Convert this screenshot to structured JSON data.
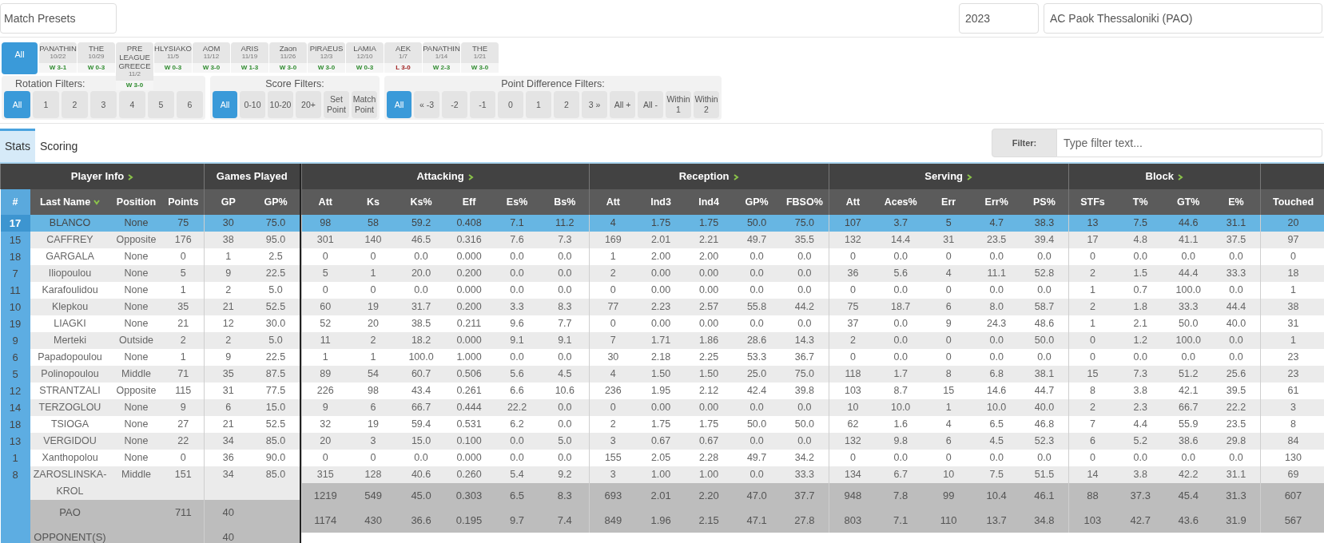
{
  "match_presets": {
    "placeholder": "Match Presets"
  },
  "season": "2023",
  "team": "AC Paok Thessaloniki (PAO)",
  "matches": [
    {
      "kind": "all",
      "label": "All",
      "selected": true
    },
    {
      "kind": "match",
      "opponent": "PANATHIN",
      "date": "10/22",
      "result": "W 3-1",
      "won": true,
      "selected": false
    },
    {
      "kind": "match",
      "opponent": "THE",
      "date": "10/29",
      "result": "W 0-3",
      "won": true,
      "selected": false
    },
    {
      "kind": "match",
      "opponent": "PRE LEAGUE GREECE",
      "date": "11/2",
      "result": "W 3-0",
      "won": true,
      "selected": false
    },
    {
      "kind": "match",
      "opponent": "HLYSIAKO",
      "date": "11/5",
      "result": "W 0-3",
      "won": true,
      "selected": false
    },
    {
      "kind": "match",
      "opponent": "AOM",
      "date": "11/12",
      "result": "W 3-0",
      "won": true,
      "selected": false
    },
    {
      "kind": "match",
      "opponent": "ARIS",
      "date": "11/19",
      "result": "W 1-3",
      "won": true,
      "selected": false
    },
    {
      "kind": "match",
      "opponent": "Zaon",
      "date": "11/26",
      "result": "W 3-0",
      "won": true,
      "selected": false
    },
    {
      "kind": "match",
      "opponent": "PIRAEUS",
      "date": "12/3",
      "result": "W 3-0",
      "won": true,
      "selected": false
    },
    {
      "kind": "match",
      "opponent": "LAMIA",
      "date": "12/10",
      "result": "W 0-3",
      "won": true,
      "selected": false
    },
    {
      "kind": "match",
      "opponent": "AEK",
      "date": "1/7",
      "result": "L 3-0",
      "won": false,
      "selected": false
    },
    {
      "kind": "match",
      "opponent": "PANATHIN",
      "date": "1/14",
      "result": "W 2-3",
      "won": true,
      "selected": false
    },
    {
      "kind": "match",
      "opponent": "THE",
      "date": "1/21",
      "result": "W 3-0",
      "won": true,
      "selected": false
    }
  ],
  "filter_groups": [
    {
      "title": "Rotation Filters:",
      "buttons": [
        {
          "label": "All",
          "selected": true
        },
        {
          "label": "1",
          "selected": false
        },
        {
          "label": "2",
          "selected": false
        },
        {
          "label": "3",
          "selected": false
        },
        {
          "label": "4",
          "selected": false
        },
        {
          "label": "5",
          "selected": false
        },
        {
          "label": "6",
          "selected": false
        }
      ]
    },
    {
      "title": "Score Filters:",
      "buttons": [
        {
          "label": "All",
          "selected": true
        },
        {
          "label": "0-10",
          "selected": false
        },
        {
          "label": "10-20",
          "selected": false
        },
        {
          "label": "20+",
          "selected": false
        },
        {
          "label": "Set Point",
          "selected": false
        },
        {
          "label": "Match Point",
          "selected": false
        }
      ]
    },
    {
      "title": "Point Difference Filters:",
      "buttons": [
        {
          "label": "All",
          "selected": true
        },
        {
          "label": "« -3",
          "selected": false
        },
        {
          "label": "-2",
          "selected": false
        },
        {
          "label": "-1",
          "selected": false
        },
        {
          "label": "0",
          "selected": false
        },
        {
          "label": "1",
          "selected": false
        },
        {
          "label": "2",
          "selected": false
        },
        {
          "label": "3 »",
          "selected": false
        },
        {
          "label": "All +",
          "selected": false
        },
        {
          "label": "All -",
          "selected": false
        },
        {
          "label": "Within 1",
          "selected": false
        },
        {
          "label": "Within 2",
          "selected": false
        }
      ]
    }
  ],
  "tabs": [
    {
      "label": "Stats",
      "selected": true
    },
    {
      "label": "Scoring",
      "selected": false
    }
  ],
  "filter": {
    "label": "Filter:",
    "placeholder": "Type filter text..."
  },
  "table": {
    "groups": [
      {
        "label": "Player Info",
        "expandable": true,
        "columns": [
          {
            "label": "#",
            "sorted": false
          },
          {
            "label": "Last Name",
            "sorted": true
          },
          {
            "label": "Position",
            "sorted": false
          },
          {
            "label": "Points",
            "sorted": false
          }
        ]
      },
      {
        "label": "Games Played",
        "expandable": false,
        "columns": [
          {
            "label": "GP",
            "sorted": false
          },
          {
            "label": "GP%",
            "sorted": false
          }
        ]
      },
      {
        "label": "Attacking",
        "expandable": true,
        "columns": [
          {
            "label": "Att",
            "sorted": false
          },
          {
            "label": "Ks",
            "sorted": false
          },
          {
            "label": "Ks%",
            "sorted": false
          },
          {
            "label": "Eff",
            "sorted": false
          },
          {
            "label": "Es%",
            "sorted": false
          },
          {
            "label": "Bs%",
            "sorted": false
          }
        ]
      },
      {
        "label": "Reception",
        "expandable": true,
        "columns": [
          {
            "label": "Att",
            "sorted": false
          },
          {
            "label": "Ind3",
            "sorted": false
          },
          {
            "label": "Ind4",
            "sorted": false
          },
          {
            "label": "GP%",
            "sorted": false
          },
          {
            "label": "FBSO%",
            "sorted": false
          }
        ]
      },
      {
        "label": "Serving",
        "expandable": true,
        "columns": [
          {
            "label": "Att",
            "sorted": false
          },
          {
            "label": "Aces%",
            "sorted": false
          },
          {
            "label": "Err",
            "sorted": false
          },
          {
            "label": "Err%",
            "sorted": false
          },
          {
            "label": "PS%",
            "sorted": false
          }
        ]
      },
      {
        "label": "Block",
        "expandable": true,
        "columns": [
          {
            "label": "STFs",
            "sorted": false
          },
          {
            "label": "T%",
            "sorted": false
          },
          {
            "label": "GT%",
            "sorted": false
          },
          {
            "label": "E%",
            "sorted": false
          }
        ]
      },
      {
        "expandable": false,
        "columns": [
          {
            "label": "Touched",
            "sorted": false
          }
        ]
      }
    ],
    "rows": [
      {
        "selected": true,
        "cells": [
          "17",
          "BLANCO",
          "None",
          "75",
          "30",
          "75.0",
          "98",
          "58",
          "59.2",
          "0.408",
          "7.1",
          "11.2",
          "4",
          "1.75",
          "1.75",
          "50.0",
          "75.0",
          "107",
          "3.7",
          "5",
          "4.7",
          "38.3",
          "13",
          "7.5",
          "44.6",
          "31.1",
          "20"
        ]
      },
      {
        "selected": false,
        "cells": [
          "15",
          "CAFFREY",
          "Opposite",
          "176",
          "38",
          "95.0",
          "301",
          "140",
          "46.5",
          "0.316",
          "7.6",
          "7.3",
          "169",
          "2.01",
          "2.21",
          "49.7",
          "35.5",
          "132",
          "14.4",
          "31",
          "23.5",
          "39.4",
          "17",
          "4.8",
          "41.1",
          "37.5",
          "97"
        ]
      },
      {
        "selected": false,
        "cells": [
          "18",
          "GARGALA",
          "None",
          "0",
          "1",
          "2.5",
          "0",
          "0",
          "0.0",
          "0.000",
          "0.0",
          "0.0",
          "1",
          "2.00",
          "2.00",
          "0.0",
          "0.0",
          "0",
          "0.0",
          "0",
          "0.0",
          "0.0",
          "0",
          "0.0",
          "0.0",
          "0.0",
          "0"
        ]
      },
      {
        "selected": false,
        "cells": [
          "7",
          "Iliopoulou",
          "None",
          "5",
          "9",
          "22.5",
          "5",
          "1",
          "20.0",
          "0.200",
          "0.0",
          "0.0",
          "2",
          "0.00",
          "0.00",
          "0.0",
          "0.0",
          "36",
          "5.6",
          "4",
          "11.1",
          "52.8",
          "2",
          "1.5",
          "44.4",
          "33.3",
          "18"
        ]
      },
      {
        "selected": false,
        "cells": [
          "11",
          "Karafoulidou",
          "None",
          "1",
          "2",
          "5.0",
          "0",
          "0",
          "0.0",
          "0.000",
          "0.0",
          "0.0",
          "0",
          "0.00",
          "0.00",
          "0.0",
          "0.0",
          "0",
          "0.0",
          "0",
          "0.0",
          "0.0",
          "1",
          "0.7",
          "100.0",
          "0.0",
          "1"
        ]
      },
      {
        "selected": false,
        "cells": [
          "10",
          "Klepkou",
          "None",
          "35",
          "21",
          "52.5",
          "60",
          "19",
          "31.7",
          "0.200",
          "3.3",
          "8.3",
          "77",
          "2.23",
          "2.57",
          "55.8",
          "44.2",
          "75",
          "18.7",
          "6",
          "8.0",
          "58.7",
          "2",
          "1.8",
          "33.3",
          "44.4",
          "38"
        ]
      },
      {
        "selected": false,
        "cells": [
          "19",
          "LIAGKI",
          "None",
          "21",
          "12",
          "30.0",
          "52",
          "20",
          "38.5",
          "0.211",
          "9.6",
          "7.7",
          "0",
          "0.00",
          "0.00",
          "0.0",
          "0.0",
          "37",
          "0.0",
          "9",
          "24.3",
          "48.6",
          "1",
          "2.1",
          "50.0",
          "40.0",
          "31"
        ]
      },
      {
        "selected": false,
        "cells": [
          "9",
          "Merteki",
          "Outside",
          "2",
          "2",
          "5.0",
          "11",
          "2",
          "18.2",
          "0.000",
          "9.1",
          "9.1",
          "7",
          "1.71",
          "1.86",
          "28.6",
          "14.3",
          "2",
          "0.0",
          "0",
          "0.0",
          "50.0",
          "0",
          "1.2",
          "100.0",
          "0.0",
          "1"
        ]
      },
      {
        "selected": false,
        "cells": [
          "6",
          "Papadopoulou",
          "None",
          "1",
          "9",
          "22.5",
          "1",
          "1",
          "100.0",
          "1.000",
          "0.0",
          "0.0",
          "30",
          "2.18",
          "2.25",
          "53.3",
          "36.7",
          "0",
          "0.0",
          "0",
          "0.0",
          "0.0",
          "0",
          "0.0",
          "0.0",
          "0.0",
          "23"
        ]
      },
      {
        "selected": false,
        "cells": [
          "5",
          "Polinopoulou",
          "Middle",
          "71",
          "35",
          "87.5",
          "89",
          "54",
          "60.7",
          "0.506",
          "5.6",
          "4.5",
          "4",
          "1.50",
          "1.50",
          "25.0",
          "75.0",
          "118",
          "1.7",
          "8",
          "6.8",
          "38.1",
          "15",
          "7.3",
          "51.2",
          "25.6",
          "23"
        ]
      },
      {
        "selected": false,
        "cells": [
          "12",
          "STRANTZALI",
          "Opposite",
          "115",
          "31",
          "77.5",
          "226",
          "98",
          "43.4",
          "0.261",
          "6.6",
          "10.6",
          "236",
          "1.95",
          "2.12",
          "42.4",
          "39.8",
          "103",
          "8.7",
          "15",
          "14.6",
          "44.7",
          "8",
          "3.8",
          "42.1",
          "39.5",
          "61"
        ]
      },
      {
        "selected": false,
        "cells": [
          "14",
          "TERZOGLOU",
          "None",
          "9",
          "6",
          "15.0",
          "9",
          "6",
          "66.7",
          "0.444",
          "22.2",
          "0.0",
          "0",
          "0.00",
          "0.00",
          "0.0",
          "0.0",
          "10",
          "10.0",
          "1",
          "10.0",
          "40.0",
          "2",
          "2.3",
          "66.7",
          "22.2",
          "3"
        ]
      },
      {
        "selected": false,
        "cells": [
          "18",
          "TSIOGA",
          "None",
          "27",
          "21",
          "52.5",
          "32",
          "19",
          "59.4",
          "0.531",
          "6.2",
          "0.0",
          "2",
          "1.75",
          "1.75",
          "50.0",
          "50.0",
          "62",
          "1.6",
          "4",
          "6.5",
          "46.8",
          "7",
          "4.4",
          "55.9",
          "23.5",
          "8"
        ]
      },
      {
        "selected": false,
        "cells": [
          "13",
          "VERGIDOU",
          "None",
          "22",
          "34",
          "85.0",
          "20",
          "3",
          "15.0",
          "0.100",
          "0.0",
          "5.0",
          "3",
          "0.67",
          "0.67",
          "0.0",
          "0.0",
          "132",
          "9.8",
          "6",
          "4.5",
          "52.3",
          "6",
          "5.2",
          "38.6",
          "29.8",
          "84"
        ]
      },
      {
        "selected": false,
        "cells": [
          "1",
          "Xanthopolou",
          "None",
          "0",
          "36",
          "90.0",
          "0",
          "0",
          "0.0",
          "0.000",
          "0.0",
          "0.0",
          "155",
          "2.05",
          "2.28",
          "49.7",
          "34.2",
          "0",
          "0.0",
          "0",
          "0.0",
          "0.0",
          "0",
          "0.0",
          "0.0",
          "0.0",
          "130"
        ]
      },
      {
        "selected": false,
        "cells": [
          "8",
          "ZAROSLINSKA-KROL",
          "Middle",
          "151",
          "34",
          "85.0",
          "315",
          "128",
          "40.6",
          "0.260",
          "5.4",
          "9.2",
          "3",
          "1.00",
          "1.00",
          "0.0",
          "33.3",
          "134",
          "6.7",
          "10",
          "7.5",
          "51.5",
          "14",
          "3.8",
          "42.2",
          "31.1",
          "69"
        ]
      }
    ],
    "totals": [
      {
        "label": "PAO",
        "points": "711",
        "gp": "40",
        "stats": [
          "1219",
          "549",
          "45.0",
          "0.303",
          "6.5",
          "8.3",
          "693",
          "2.01",
          "2.20",
          "47.0",
          "37.7",
          "948",
          "7.8",
          "99",
          "10.4",
          "46.1",
          "88",
          "37.3",
          "45.4",
          "31.3",
          "607"
        ]
      },
      {
        "label": "OPPONENT(S)",
        "gp": "40",
        "stats": [
          "1174",
          "430",
          "36.6",
          "0.195",
          "9.7",
          "7.4",
          "849",
          "1.96",
          "2.15",
          "47.1",
          "27.8",
          "803",
          "7.1",
          "110",
          "13.7",
          "34.8",
          "103",
          "42.7",
          "43.6",
          "31.9",
          "567"
        ]
      }
    ]
  }
}
